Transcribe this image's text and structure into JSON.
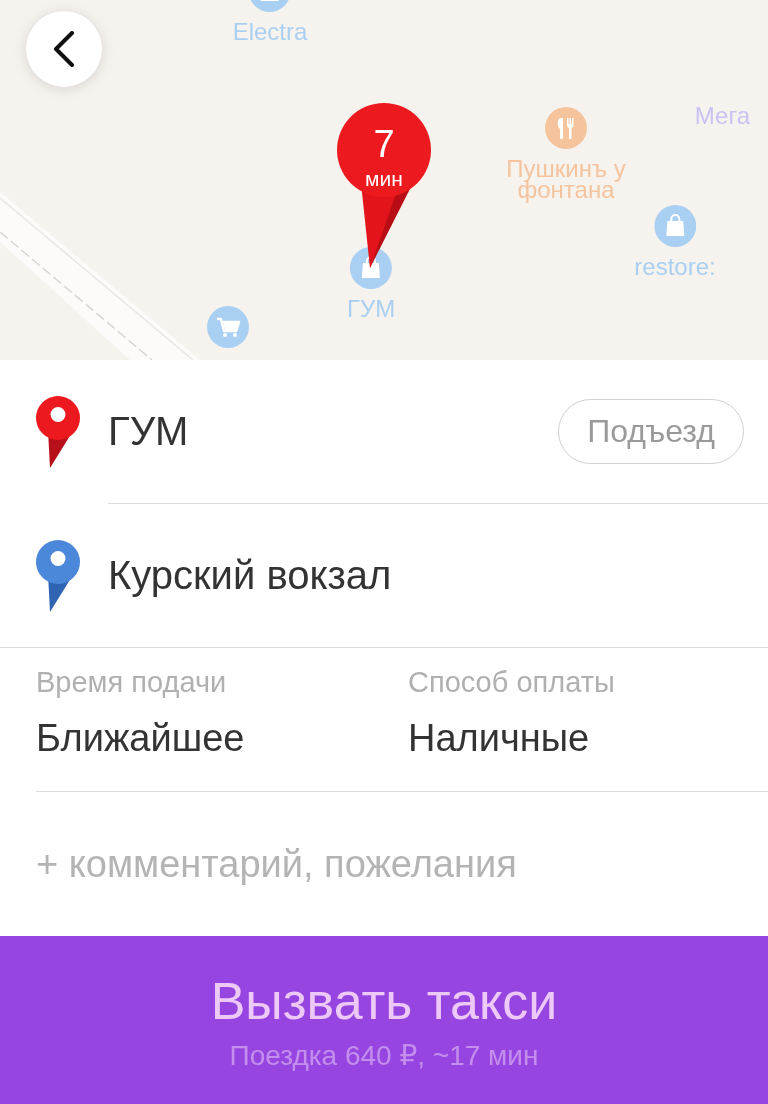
{
  "map": {
    "places": [
      {
        "kind": "shop",
        "label": "Electra",
        "color": "#a9cff3"
      },
      {
        "kind": "other",
        "label": "Мега",
        "color": "#c9c2f3"
      },
      {
        "kind": "restaurant",
        "label": "Пушкинъ у фонтана",
        "color": "#f5c39c"
      },
      {
        "kind": "shop",
        "label": "restore:",
        "color": "#a9cff3"
      },
      {
        "kind": "shop",
        "label": "ГУМ",
        "color": "#a9cff3"
      },
      {
        "kind": "grocery",
        "color": "#a9cff3"
      }
    ],
    "eta_pin": {
      "value": "7",
      "unit": "мин"
    }
  },
  "route": [
    {
      "kind": "pickup",
      "address": "ГУМ",
      "action": "Подъезд"
    },
    {
      "kind": "destination",
      "address": "Курский вокзал"
    }
  ],
  "options": [
    {
      "label": "Время подачи",
      "value": "Ближайшее"
    },
    {
      "label": "Способ оплаты",
      "value": "Наличные"
    }
  ],
  "comment_button": "+ комментарий, пожелания",
  "order_button": {
    "title": "Вызвать такси",
    "subtitle": "Поездка 640 ₽, ~17 мин"
  }
}
